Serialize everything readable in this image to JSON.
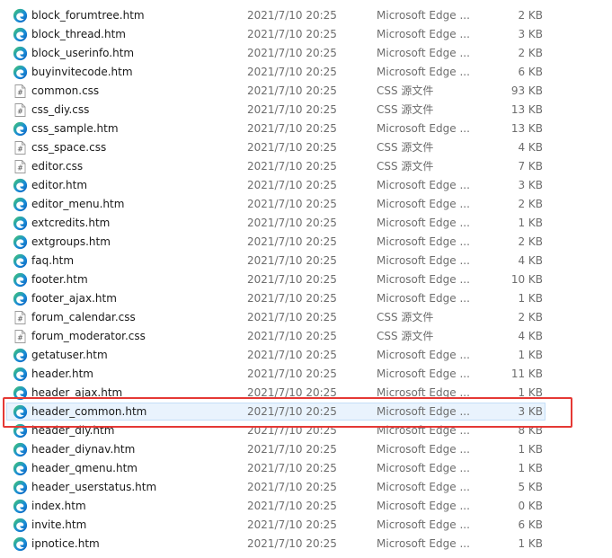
{
  "files": [
    {
      "name": "block_forumtree.htm",
      "date": "2021/7/10 20:25",
      "type": "Microsoft Edge ...",
      "size": "2 KB",
      "icon": "edge-icon"
    },
    {
      "name": "block_thread.htm",
      "date": "2021/7/10 20:25",
      "type": "Microsoft Edge ...",
      "size": "3 KB",
      "icon": "edge-icon"
    },
    {
      "name": "block_userinfo.htm",
      "date": "2021/7/10 20:25",
      "type": "Microsoft Edge ...",
      "size": "2 KB",
      "icon": "edge-icon"
    },
    {
      "name": "buyinvitecode.htm",
      "date": "2021/7/10 20:25",
      "type": "Microsoft Edge ...",
      "size": "6 KB",
      "icon": "edge-icon"
    },
    {
      "name": "common.css",
      "date": "2021/7/10 20:25",
      "type": "CSS 源文件",
      "size": "93 KB",
      "icon": "css-file-icon"
    },
    {
      "name": "css_diy.css",
      "date": "2021/7/10 20:25",
      "type": "CSS 源文件",
      "size": "13 KB",
      "icon": "css-file-icon"
    },
    {
      "name": "css_sample.htm",
      "date": "2021/7/10 20:25",
      "type": "Microsoft Edge ...",
      "size": "13 KB",
      "icon": "edge-icon"
    },
    {
      "name": "css_space.css",
      "date": "2021/7/10 20:25",
      "type": "CSS 源文件",
      "size": "4 KB",
      "icon": "css-file-icon"
    },
    {
      "name": "editor.css",
      "date": "2021/7/10 20:25",
      "type": "CSS 源文件",
      "size": "7 KB",
      "icon": "css-file-icon"
    },
    {
      "name": "editor.htm",
      "date": "2021/7/10 20:25",
      "type": "Microsoft Edge ...",
      "size": "3 KB",
      "icon": "edge-icon"
    },
    {
      "name": "editor_menu.htm",
      "date": "2021/7/10 20:25",
      "type": "Microsoft Edge ...",
      "size": "2 KB",
      "icon": "edge-icon"
    },
    {
      "name": "extcredits.htm",
      "date": "2021/7/10 20:25",
      "type": "Microsoft Edge ...",
      "size": "1 KB",
      "icon": "edge-icon"
    },
    {
      "name": "extgroups.htm",
      "date": "2021/7/10 20:25",
      "type": "Microsoft Edge ...",
      "size": "2 KB",
      "icon": "edge-icon"
    },
    {
      "name": "faq.htm",
      "date": "2021/7/10 20:25",
      "type": "Microsoft Edge ...",
      "size": "4 KB",
      "icon": "edge-icon"
    },
    {
      "name": "footer.htm",
      "date": "2021/7/10 20:25",
      "type": "Microsoft Edge ...",
      "size": "10 KB",
      "icon": "edge-icon"
    },
    {
      "name": "footer_ajax.htm",
      "date": "2021/7/10 20:25",
      "type": "Microsoft Edge ...",
      "size": "1 KB",
      "icon": "edge-icon"
    },
    {
      "name": "forum_calendar.css",
      "date": "2021/7/10 20:25",
      "type": "CSS 源文件",
      "size": "2 KB",
      "icon": "css-file-icon"
    },
    {
      "name": "forum_moderator.css",
      "date": "2021/7/10 20:25",
      "type": "CSS 源文件",
      "size": "4 KB",
      "icon": "css-file-icon"
    },
    {
      "name": "getatuser.htm",
      "date": "2021/7/10 20:25",
      "type": "Microsoft Edge ...",
      "size": "1 KB",
      "icon": "edge-icon"
    },
    {
      "name": "header.htm",
      "date": "2021/7/10 20:25",
      "type": "Microsoft Edge ...",
      "size": "11 KB",
      "icon": "edge-icon"
    },
    {
      "name": "header_ajax.htm",
      "date": "2021/7/10 20:25",
      "type": "Microsoft Edge ...",
      "size": "1 KB",
      "icon": "edge-icon"
    },
    {
      "name": "header_common.htm",
      "date": "2021/7/10 20:25",
      "type": "Microsoft Edge ...",
      "size": "3 KB",
      "icon": "edge-icon",
      "selected": true
    },
    {
      "name": "header_diy.htm",
      "date": "2021/7/10 20:25",
      "type": "Microsoft Edge ...",
      "size": "8 KB",
      "icon": "edge-icon"
    },
    {
      "name": "header_diynav.htm",
      "date": "2021/7/10 20:25",
      "type": "Microsoft Edge ...",
      "size": "1 KB",
      "icon": "edge-icon"
    },
    {
      "name": "header_qmenu.htm",
      "date": "2021/7/10 20:25",
      "type": "Microsoft Edge ...",
      "size": "1 KB",
      "icon": "edge-icon"
    },
    {
      "name": "header_userstatus.htm",
      "date": "2021/7/10 20:25",
      "type": "Microsoft Edge ...",
      "size": "5 KB",
      "icon": "edge-icon"
    },
    {
      "name": "index.htm",
      "date": "2021/7/10 20:25",
      "type": "Microsoft Edge ...",
      "size": "0 KB",
      "icon": "edge-icon"
    },
    {
      "name": "invite.htm",
      "date": "2021/7/10 20:25",
      "type": "Microsoft Edge ...",
      "size": "6 KB",
      "icon": "edge-icon"
    },
    {
      "name": "ipnotice.htm",
      "date": "2021/7/10 20:25",
      "type": "Microsoft Edge ...",
      "size": "1 KB",
      "icon": "edge-icon"
    }
  ],
  "colors": {
    "selection_bg": "#e9f3fd",
    "highlight_border": "#e53935",
    "edge_blue": "#1a73d9",
    "edge_green": "#3fbd5a"
  }
}
